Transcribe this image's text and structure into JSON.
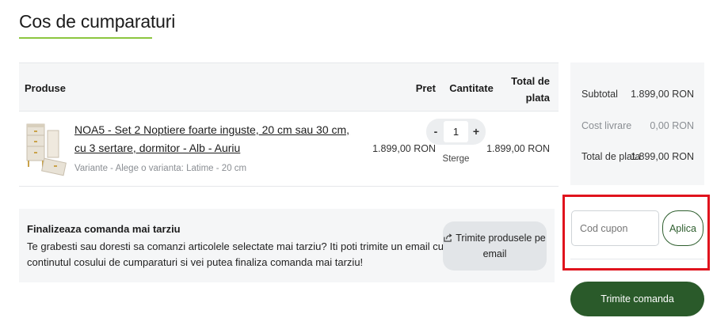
{
  "page": {
    "title": "Cos de cumparaturi",
    "accent_color": "#8cc63f"
  },
  "table": {
    "headers": {
      "products": "Produse",
      "price": "Pret",
      "quantity": "Cantitate",
      "total": "Total de plata"
    },
    "items": [
      {
        "name": "NOA5 - Set 2 Noptiere foarte inguste, 20 cm sau 30 cm, cu 3 sertare, dormitor - Alb - Auriu",
        "variant": "Variante - Alege o varianta: Latime - 20 cm",
        "price": "1.899,00 RON",
        "quantity": "1",
        "quantity_minus": "-",
        "quantity_plus": "+",
        "remove_label": "Sterge",
        "total": "1.899,00 RON",
        "thumbnail_icon": "nightstand-product-image"
      }
    ]
  },
  "later": {
    "title": "Finalizeaza comanda mai tarziu",
    "text": "Te grabesti sau doresti sa comanzi articolele selectate mai tarziu? Iti poti trimite un email cu continutul cosului de cumparaturi si vei putea finaliza comanda mai tarziu!",
    "email_button": "Trimite produsele pe email",
    "email_icon": "share-icon"
  },
  "summary": {
    "subtotal_label": "Subtotal",
    "subtotal_value": "1.899,00 RON",
    "shipping_label": "Cost livrare",
    "shipping_value": "0,00 RON",
    "total_label": "Total de plata",
    "total_value": "1.899,00 RON"
  },
  "coupon": {
    "placeholder": "Cod cupon",
    "apply_label": "Aplica",
    "highlight_color": "#e0131d"
  },
  "submit": {
    "label": "Trimite comanda",
    "color": "#2a5a2a"
  }
}
